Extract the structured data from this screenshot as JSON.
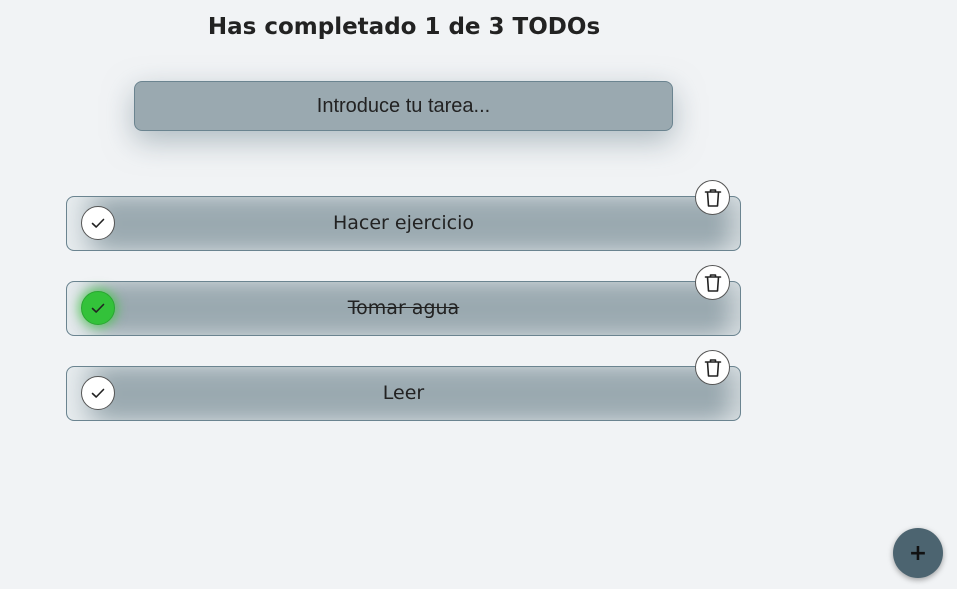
{
  "header": {
    "title": "Has completado 1 de 3 TODOs"
  },
  "input": {
    "placeholder": "Introduce tu tarea...",
    "value": ""
  },
  "todos": [
    {
      "text": "Hacer ejercicio",
      "completed": false
    },
    {
      "text": "Tomar agua",
      "completed": true
    },
    {
      "text": "Leer",
      "completed": false
    }
  ],
  "icons": {
    "check": "check-icon",
    "delete": "trash-icon",
    "add": "plus-icon"
  },
  "fab": {
    "label": "+"
  },
  "colors": {
    "background": "#f1f3f5",
    "item": "#9aa9b0",
    "completed": "#33c23a",
    "fab": "#4c6470"
  }
}
